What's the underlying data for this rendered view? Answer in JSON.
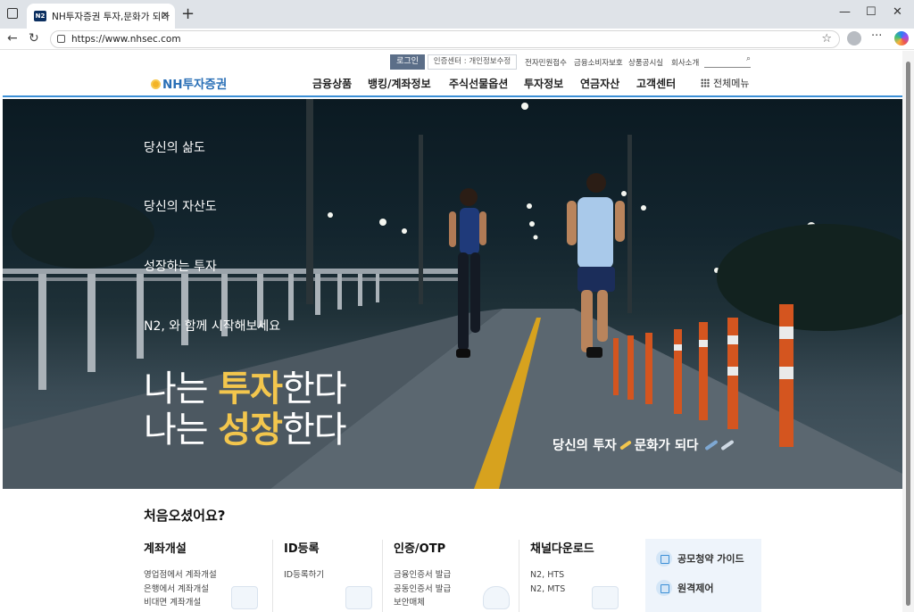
{
  "browser": {
    "tab_title": "NH투자증권 투자,문화가 되다",
    "tab_favicon": "N2",
    "url": "https://www.nhsec.com",
    "new_tab": "+",
    "window_controls": [
      "—",
      "☐",
      "✕"
    ]
  },
  "util_nav": {
    "login": "로그인",
    "cert_center": "인증센터 : 개인정보수정",
    "links": [
      "전자민원접수",
      "금융소비자보호",
      "상품공시실",
      "회사소개"
    ]
  },
  "gnb": {
    "logo": "NH투자증권",
    "menus": [
      "금융상품",
      "뱅킹/계좌정보",
      "주식선물옵션",
      "투자정보",
      "연금자산",
      "고객센터"
    ],
    "all_menu": "전체메뉴"
  },
  "hero": {
    "lines": [
      "당신의 삶도",
      "당신의 자산도",
      "성장하는 투자",
      "N2, 와 함께 시작해보세요"
    ],
    "slogan1_pre": "나는 ",
    "slogan1_hl": "투자",
    "slogan1_post": "한다",
    "slogan2_pre": "나는 ",
    "slogan2_hl": "성장",
    "slogan2_post": "한다",
    "tagline_a": "당신의 투자",
    "tagline_b": "문화가 되다",
    "accent_color": "#f3c64d"
  },
  "welcome": {
    "title": "처음오셨어요?",
    "columns": [
      {
        "title": "계좌개설",
        "items": [
          "영업점에서 계좌개설",
          "은행에서 계좌개설",
          "비대면 계좌개설"
        ]
      },
      {
        "title": "ID등록",
        "items": [
          "ID등록하기"
        ]
      },
      {
        "title": "인증/OTP",
        "items": [
          "금융인증서 발급",
          "공동인증서 발급",
          "보안매체"
        ]
      },
      {
        "title": "채널다운로드",
        "items": [
          "N2, HTS",
          "N2, MTS"
        ]
      }
    ],
    "side": [
      "공모청약 가이드",
      "원격제어"
    ]
  }
}
